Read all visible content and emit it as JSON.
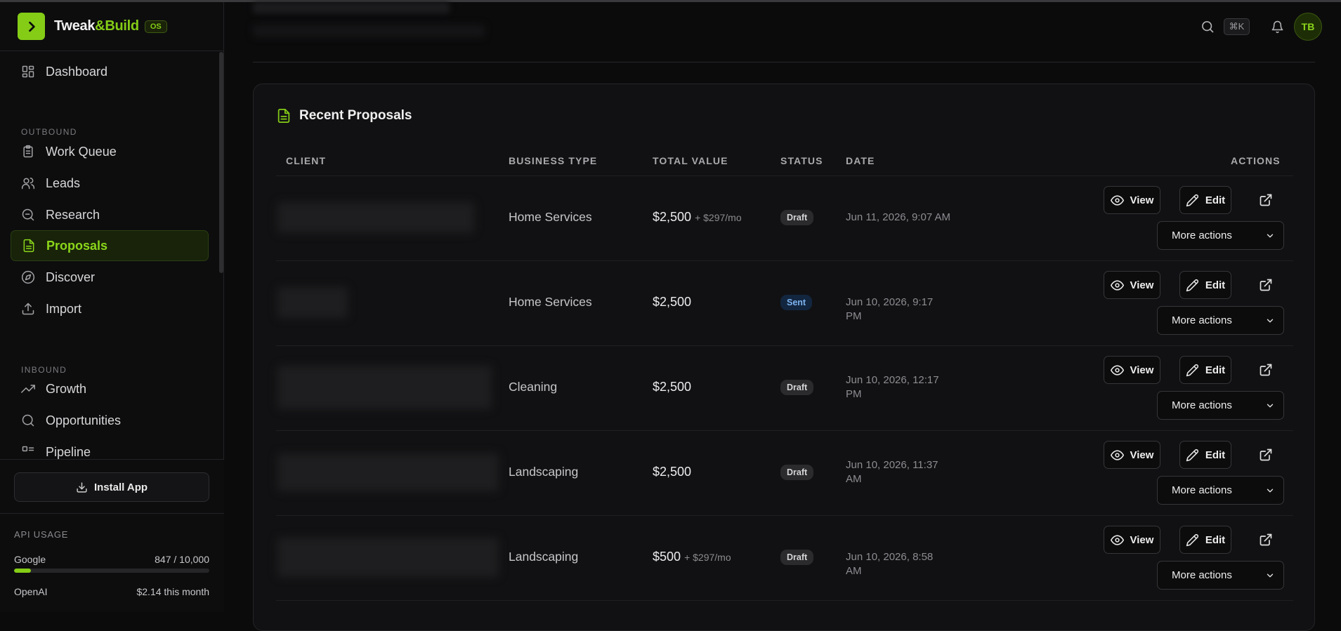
{
  "brand": {
    "name_main": "Tweak",
    "name_accent": "&Build",
    "badge": "OS"
  },
  "sidebar": {
    "items": [
      {
        "label": "Dashboard",
        "icon": "dashboard-icon"
      },
      {
        "label": "Work Queue",
        "icon": "clipboard-icon"
      },
      {
        "label": "Leads",
        "icon": "users-icon"
      },
      {
        "label": "Research",
        "icon": "search-doc-icon"
      },
      {
        "label": "Proposals",
        "icon": "file-text-icon",
        "active": true
      },
      {
        "label": "Discover",
        "icon": "compass-icon"
      },
      {
        "label": "Import",
        "icon": "upload-icon"
      },
      {
        "label": "Growth",
        "icon": "trending-up-icon"
      },
      {
        "label": "Opportunities",
        "icon": "search-icon"
      },
      {
        "label": "Pipeline",
        "icon": "kanban-icon"
      }
    ],
    "sections": {
      "outbound": "OUTBOUND",
      "inbound": "INBOUND"
    },
    "install_label": "Install App",
    "api": {
      "label": "API USAGE",
      "google_label": "Google",
      "google_value": "847 / 10,000",
      "google_fraction": 0.0847,
      "openai_label": "OpenAI",
      "openai_value": "$2.14 this month"
    }
  },
  "topbar": {
    "shortcut": "⌘K",
    "avatar_initials": "TB"
  },
  "proposals": {
    "title": "Recent Proposals",
    "columns": {
      "client": "CLIENT",
      "business_type": "BUSINESS TYPE",
      "total_value": "TOTAL VALUE",
      "status": "STATUS",
      "date": "DATE",
      "actions": "ACTIONS"
    },
    "view_label": "View",
    "edit_label": "Edit",
    "more_label": "More actions",
    "rows": [
      {
        "business_type": "Home Services",
        "value": "$2,500",
        "recurring": "+ $297/mo",
        "status": "Draft",
        "date": "Jun 11, 2026, 9:07 AM"
      },
      {
        "business_type": "Home Services",
        "value": "$2,500",
        "recurring": "",
        "status": "Sent",
        "date": "Jun 10, 2026, 9:17 PM"
      },
      {
        "business_type": "Cleaning",
        "value": "$2,500",
        "recurring": "",
        "status": "Draft",
        "date": "Jun 10, 2026, 12:17 PM"
      },
      {
        "business_type": "Landscaping",
        "value": "$2,500",
        "recurring": "",
        "status": "Draft",
        "date": "Jun 10, 2026, 11:37 AM"
      },
      {
        "business_type": "Landscaping",
        "value": "$500",
        "recurring": "+ $297/mo",
        "status": "Draft",
        "date": "Jun 10, 2026, 8:58 AM"
      }
    ]
  }
}
